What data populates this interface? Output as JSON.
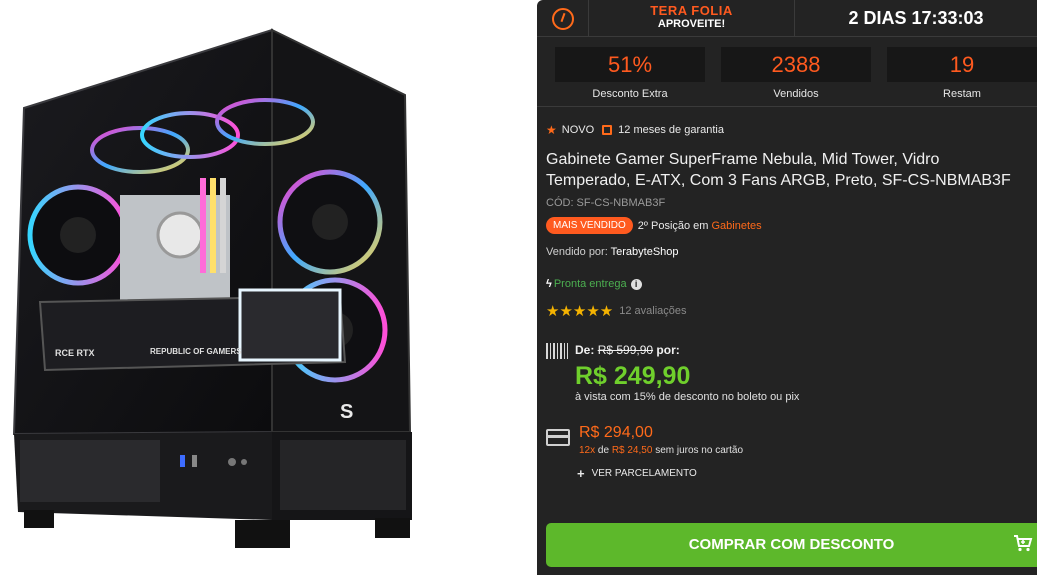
{
  "promo": {
    "title": "TERA FOLIA",
    "subtitle": "APROVEITE!",
    "timer": "2 DIAS 17:33:03"
  },
  "stats": [
    {
      "value": "51%",
      "label": "Desconto Extra"
    },
    {
      "value": "2388",
      "label": "Vendidos"
    },
    {
      "value": "19",
      "label": "Restam"
    }
  ],
  "product": {
    "new_label": "NOVO",
    "warranty": "12 meses de garantia",
    "title": "Gabinete Gamer SuperFrame Nebula, Mid Tower, Vidro Temperado, E-ATX, Com 3 Fans ARGB, Preto, SF-CS-NBMAB3F",
    "code": "CÓD: SF-CS-NBMAB3F",
    "badge": "MAIS VENDIDO",
    "ranking_prefix": "2º Posição em",
    "ranking_category": "Gabinetes",
    "seller_prefix": "Vendido por:",
    "seller": "TerabyteShop",
    "stock": "Pronta entrega",
    "stars": "★★★★★",
    "rating_value": 5,
    "reviews": "12 avaliações"
  },
  "pricing": {
    "from_label": "De:",
    "old_price": "R$ 599,90",
    "for_label": "por:",
    "price": "R$ 249,90",
    "cash_note": "à vista com 15% de desconto no boleto ou pix",
    "card_price": "R$ 294,00",
    "installment_count": "12x",
    "installment_of": "de",
    "installment_value": "R$ 24,50",
    "installment_suffix": "sem juros no cartão",
    "parcel_link": "VER PARCELAMENTO"
  },
  "buy_button": "COMPRAR COM DESCONTO",
  "colors": {
    "accent": "#ff5a1f",
    "price_green": "#6fcf2c",
    "button_green": "#5db82b",
    "panel_bg": "#232323"
  }
}
